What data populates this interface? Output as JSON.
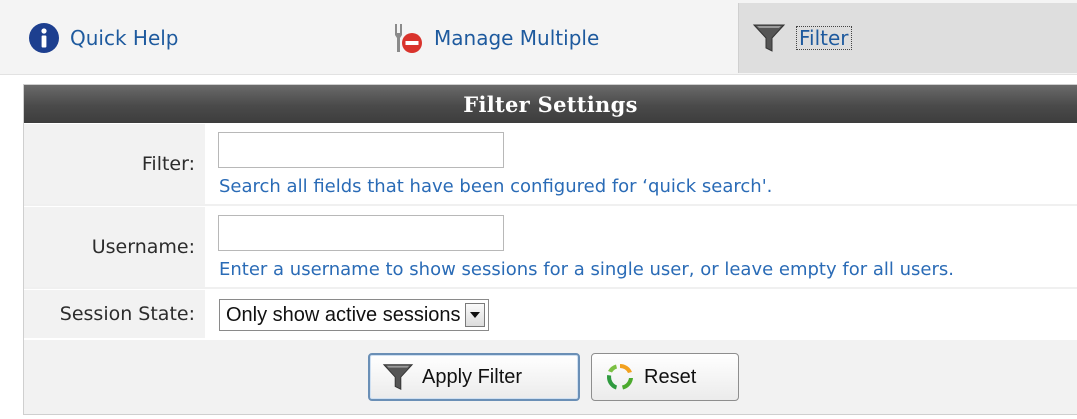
{
  "tabs": {
    "quick_help": {
      "label": "Quick Help",
      "icon": "info-icon"
    },
    "manage_multiple": {
      "label": "Manage Multiple",
      "icon": "manage-multiple-icon"
    },
    "filter": {
      "label": "Filter",
      "icon": "funnel-icon",
      "active": true
    }
  },
  "panel": {
    "title": "Filter Settings",
    "filter_row": {
      "label": "Filter:",
      "value": "",
      "hint": "Search all fields that have been configured for ‘quick search'."
    },
    "username_row": {
      "label": "Username:",
      "value": "",
      "hint": "Enter a username to show sessions for a single user, or leave empty for all users."
    },
    "session_state_row": {
      "label": "Session State:",
      "selected": "Only show active sessions"
    }
  },
  "buttons": {
    "apply": {
      "label": "Apply Filter",
      "icon": "funnel-icon"
    },
    "reset": {
      "label": "Reset",
      "icon": "refresh-icon"
    }
  },
  "colors": {
    "link": "#1e5a9e",
    "hint": "#2a6bb6",
    "header_bg": "#4a4a4a",
    "info_icon": "#1d3f8f"
  }
}
